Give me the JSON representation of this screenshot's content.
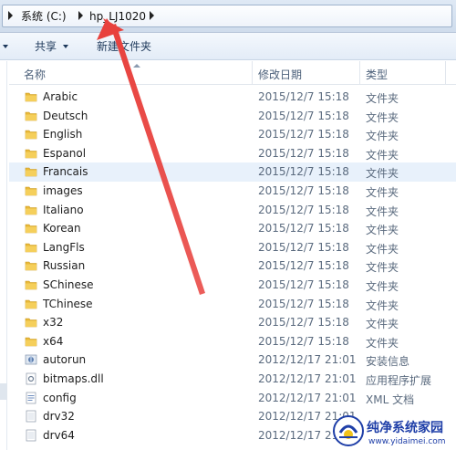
{
  "address_bar": {
    "crumbs": [
      "系统 (C:)",
      "hp_LJ1020"
    ]
  },
  "toolbar": {
    "share_label": "共享",
    "new_folder_label": "新建文件夹"
  },
  "columns": {
    "name": "名称",
    "date": "修改日期",
    "type": "类型"
  },
  "files": [
    {
      "name": "Arabic",
      "date": "2015/12/7 15:18",
      "type": "文件夹",
      "icon": "folder-icon"
    },
    {
      "name": "Deutsch",
      "date": "2015/12/7 15:18",
      "type": "文件夹",
      "icon": "folder-icon"
    },
    {
      "name": "English",
      "date": "2015/12/7 15:18",
      "type": "文件夹",
      "icon": "folder-icon"
    },
    {
      "name": "Espanol",
      "date": "2015/12/7 15:18",
      "type": "文件夹",
      "icon": "folder-icon"
    },
    {
      "name": "Francais",
      "date": "2015/12/7 15:18",
      "type": "文件夹",
      "icon": "folder-icon",
      "selected": true
    },
    {
      "name": "images",
      "date": "2015/12/7 15:18",
      "type": "文件夹",
      "icon": "folder-icon"
    },
    {
      "name": "Italiano",
      "date": "2015/12/7 15:18",
      "type": "文件夹",
      "icon": "folder-icon"
    },
    {
      "name": "Korean",
      "date": "2015/12/7 15:18",
      "type": "文件夹",
      "icon": "folder-icon"
    },
    {
      "name": "LangFls",
      "date": "2015/12/7 15:18",
      "type": "文件夹",
      "icon": "folder-icon"
    },
    {
      "name": "Russian",
      "date": "2015/12/7 15:18",
      "type": "文件夹",
      "icon": "folder-icon"
    },
    {
      "name": "SChinese",
      "date": "2015/12/7 15:18",
      "type": "文件夹",
      "icon": "folder-icon"
    },
    {
      "name": "TChinese",
      "date": "2015/12/7 15:18",
      "type": "文件夹",
      "icon": "folder-icon"
    },
    {
      "name": "x32",
      "date": "2015/12/7 15:18",
      "type": "文件夹",
      "icon": "folder-icon"
    },
    {
      "name": "x64",
      "date": "2015/12/7 15:18",
      "type": "文件夹",
      "icon": "folder-icon"
    },
    {
      "name": "autorun",
      "date": "2012/12/17 21:01",
      "type": "安装信息",
      "icon": "setup-info-icon"
    },
    {
      "name": "bitmaps.dll",
      "date": "2012/12/17 21:01",
      "type": "应用程序扩展",
      "icon": "dll-icon"
    },
    {
      "name": "config",
      "date": "2012/12/17 21:01",
      "type": "XML 文档",
      "icon": "xml-icon"
    },
    {
      "name": "drv32",
      "date": "2012/12/17 21:01",
      "type": "",
      "icon": "file-icon"
    },
    {
      "name": "drv64",
      "date": "2012/12/17 21:01",
      "type": "",
      "icon": "file-icon"
    }
  ],
  "watermark": {
    "title": "纯净系统家园",
    "url": "www.yidaimei.com"
  },
  "colors": {
    "folder": "#e8b93a",
    "annotation_arrow": "#e8413d",
    "selection": "#e8f1fb",
    "watermark": "#1f3fa8"
  }
}
